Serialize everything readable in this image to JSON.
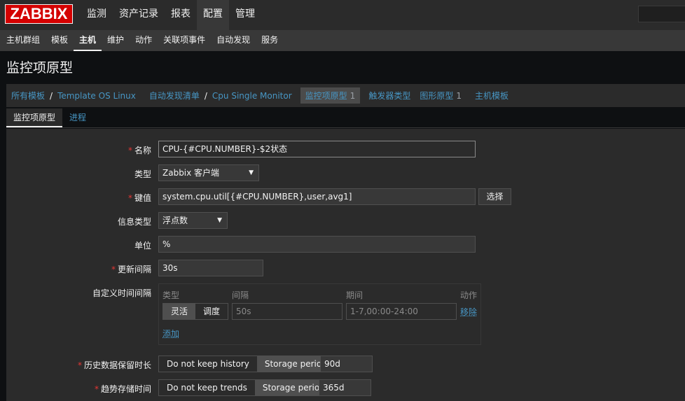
{
  "logo": "ZABBIX",
  "topnav": [
    "监测",
    "资产记录",
    "报表",
    "配置",
    "管理"
  ],
  "subnav": [
    "主机群组",
    "模板",
    "主机",
    "维护",
    "动作",
    "关联项事件",
    "自动发现",
    "服务"
  ],
  "page_title": "监控项原型",
  "breadcrumb": {
    "all_templates": "所有模板",
    "template": "Template OS Linux",
    "discovery_list": "自动发现清单",
    "rule": "Cpu Single Monitor",
    "item_prototypes": "监控项原型",
    "item_prototypes_count": "1",
    "trigger_types": "触发器类型",
    "graph_prototypes": "图形原型",
    "graph_prototypes_count": "1",
    "host_templates": "主机模板"
  },
  "tabs": [
    "监控项原型",
    "进程"
  ],
  "form": {
    "name_label": "名称",
    "name_value": "CPU-{#CPU.NUMBER}-$2状态",
    "type_label": "类型",
    "type_value": "Zabbix 客户端",
    "key_label": "键值",
    "key_value": "system.cpu.util[{#CPU.NUMBER},user,avg1]",
    "key_select_button": "选择",
    "info_type_label": "信息类型",
    "info_type_value": "浮点数",
    "units_label": "单位",
    "units_value": "%",
    "interval_label": "更新间隔",
    "interval_value": "30s",
    "custom_interval_label": "自定义时间间隔",
    "custom_interval": {
      "col_type": "类型",
      "col_interval": "间隔",
      "col_period": "期间",
      "col_action": "动作",
      "type_flexible": "灵活",
      "type_scheduling": "调度",
      "interval_value": "50s",
      "period_value": "1-7,00:00-24:00",
      "remove": "移除",
      "add": "添加"
    },
    "history_label": "历史数据保留时长",
    "history_no_keep": "Do not keep history",
    "history_storage": "Storage period",
    "history_value": "90d",
    "trends_label": "趋势存储时间",
    "trends_no_keep": "Do not keep trends",
    "trends_storage": "Storage period",
    "trends_value": "365d"
  },
  "colors": {
    "accent_link": "#4796c4",
    "required": "#e33734",
    "logo_red": "#d40000"
  }
}
